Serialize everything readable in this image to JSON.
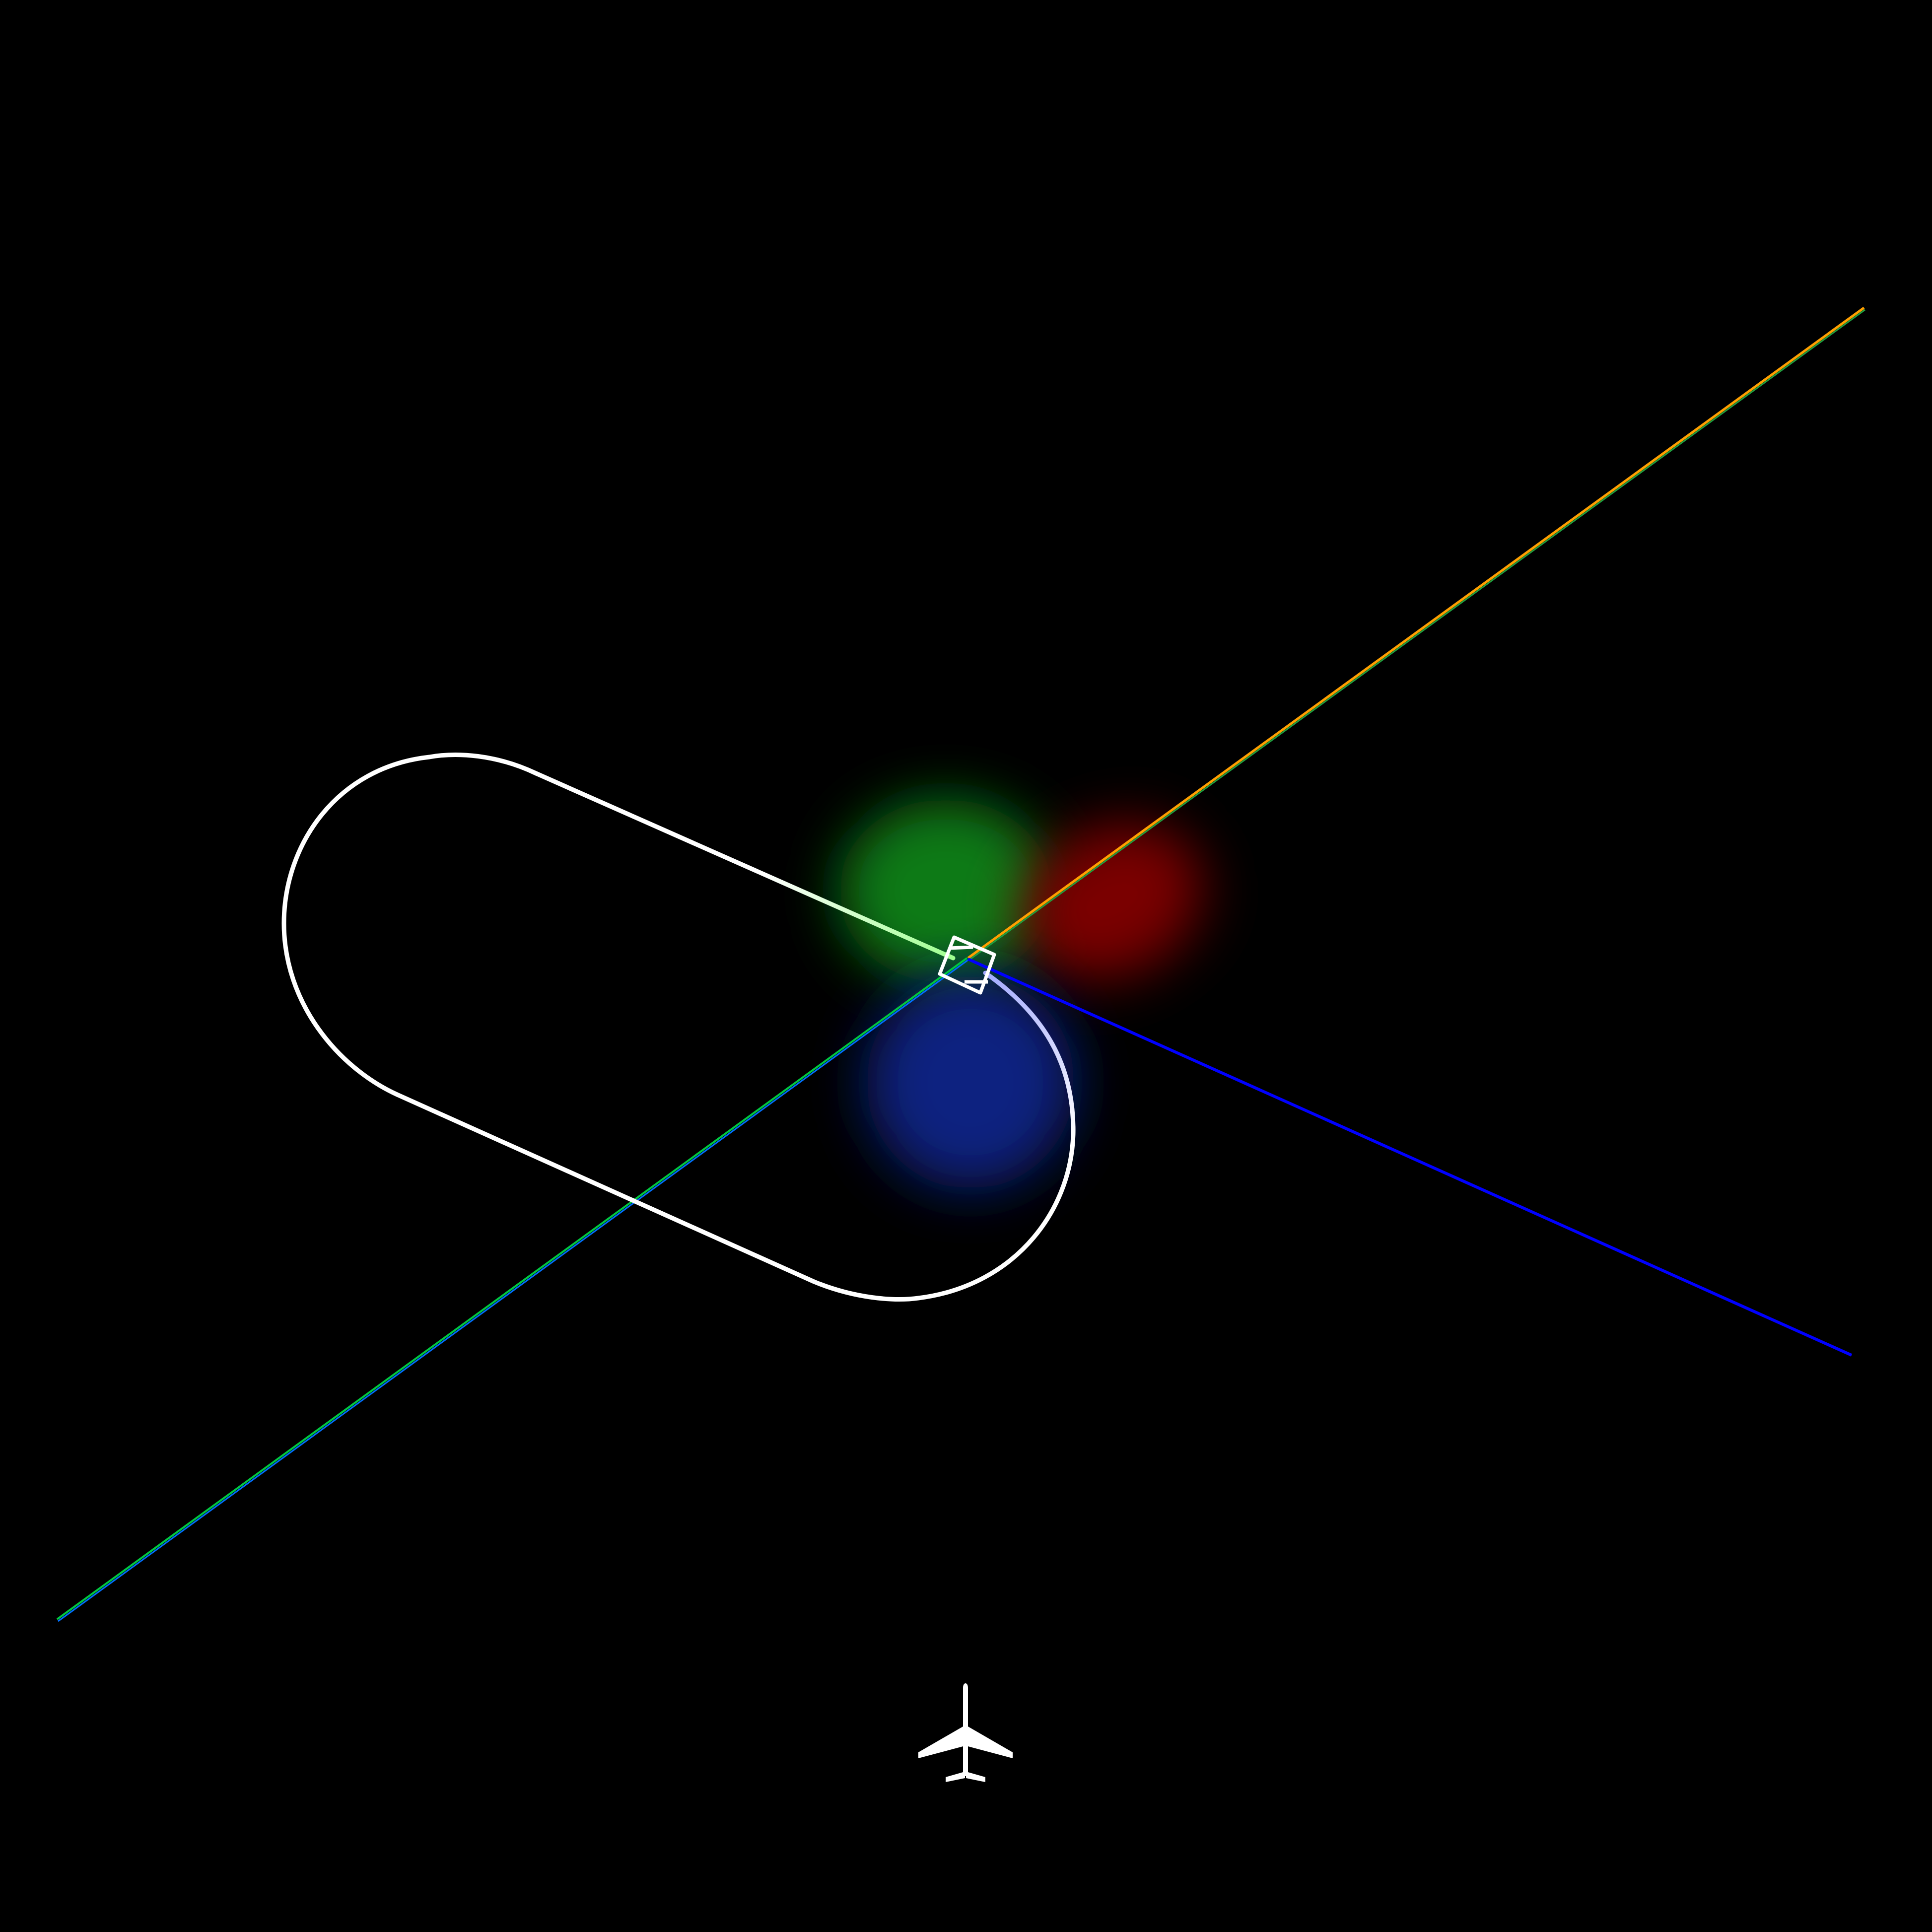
{
  "display": {
    "background": "#000000",
    "line_color": "#ffffff"
  },
  "glows": [
    {
      "name": "green",
      "color": "#0e7a12"
    },
    {
      "name": "red",
      "color": "#7a0404"
    },
    {
      "name": "blue",
      "color": "#0a2380"
    }
  ],
  "course_lines": [
    {
      "name": "course-line-northeast",
      "colors": [
        "#ffa000",
        "#00a040"
      ]
    },
    {
      "name": "course-line-southwest",
      "colors": [
        "#00c840",
        "#0060ff"
      ]
    },
    {
      "name": "course-line-southeast",
      "colors": [
        "#0000ff"
      ]
    }
  ],
  "holding_pattern": {
    "color": "#ffffff",
    "highlight_colors": [
      "#a0ff90",
      "#b0b8ff"
    ]
  },
  "icons": {
    "fix": "fix-symbol-icon",
    "aircraft": "airplane-icon"
  }
}
